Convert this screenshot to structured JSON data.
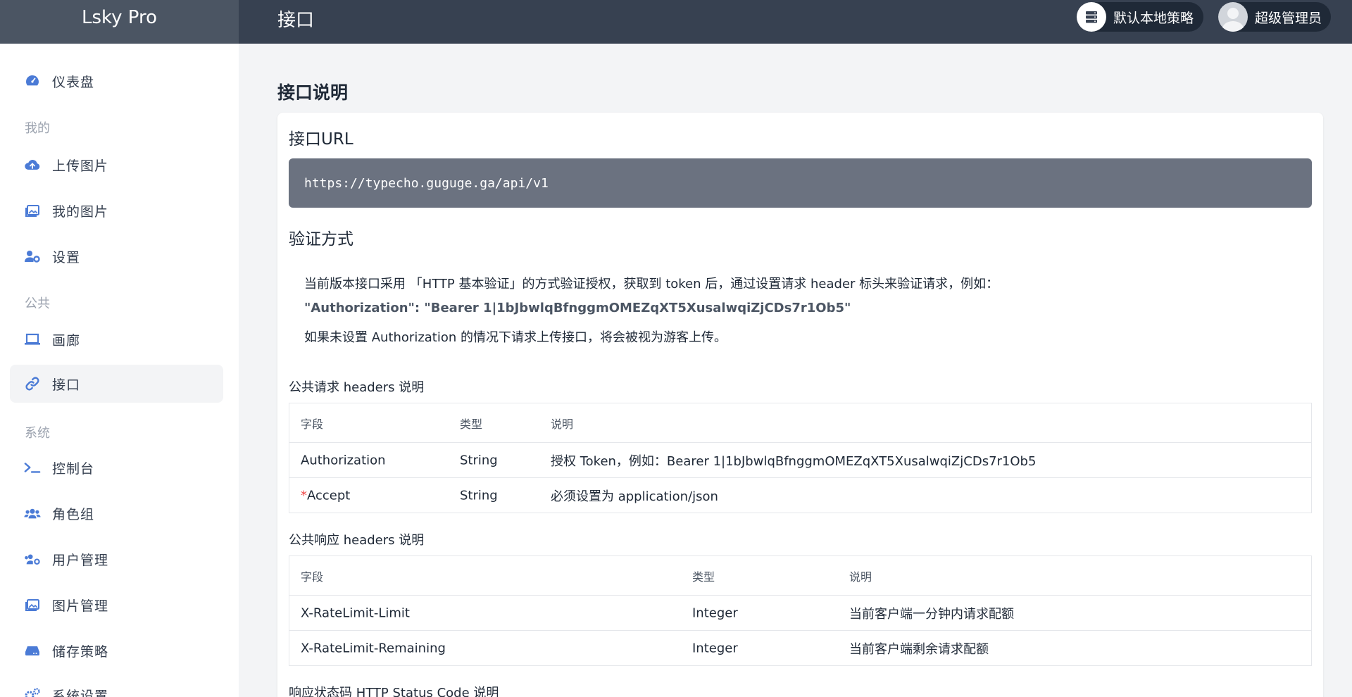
{
  "app": {
    "brand": "Lsky Pro",
    "page_title": "接口"
  },
  "header": {
    "strategy_label": "默认本地策略",
    "user_label": "超级管理员"
  },
  "sidebar": {
    "dashboard": "仪表盘",
    "section_mine": "我的",
    "upload": "上传图片",
    "my_images": "我的图片",
    "settings": "设置",
    "section_public": "公共",
    "gallery": "画廊",
    "api": "接口",
    "section_system": "系统",
    "console": "控制台",
    "roles": "角色组",
    "users": "用户管理",
    "images": "图片管理",
    "storage": "储存策略",
    "system_settings": "系统设置"
  },
  "main": {
    "heading": "接口说明",
    "url_title": "接口URL",
    "url": "https://typecho.guguge.ga/api/v1",
    "auth_title": "验证方式",
    "auth_line1": "当前版本接口采用 「HTTP 基本验证」的方式验证授权，获取到 token 后，通过设置请求 header 标头来验证请求，例如：",
    "auth_line2": "\"Authorization\": \"Bearer 1|1bJbwlqBfnggmOMEZqXT5XusalwqiZjCDs7r1Ob5\"",
    "auth_line3": "如果未设置 Authorization 的情况下请求上传接口，将会被视为游客上传。",
    "req_headers_title": "公共请求 headers 说明",
    "req_headers": {
      "columns": [
        "字段",
        "类型",
        "说明"
      ],
      "rows": [
        {
          "field": "Authorization",
          "type": "String",
          "desc": "授权 Token，例如：Bearer 1|1bJbwlqBfnggmOMEZqXT5XusalwqiZjCDs7r1Ob5"
        },
        {
          "required_mark": "*",
          "field": "Accept",
          "type": "String",
          "desc": "必须设置为 application/json"
        }
      ]
    },
    "resp_headers_title": "公共响应 headers 说明",
    "resp_headers": {
      "columns": [
        "字段",
        "类型",
        "说明"
      ],
      "rows": [
        {
          "field": "X-RateLimit-Limit",
          "type": "Integer",
          "desc": "当前客户端一分钟内请求配额"
        },
        {
          "field": "X-RateLimit-Remaining",
          "type": "Integer",
          "desc": "当前客户端剩余请求配额"
        }
      ]
    },
    "status_title": "响应状态码 HTTP Status Code 说明"
  },
  "colors": {
    "topbar": "#374151",
    "brand_bg": "#4b5563",
    "accent": "#4b7bd6",
    "url_box": "#6b7280"
  }
}
